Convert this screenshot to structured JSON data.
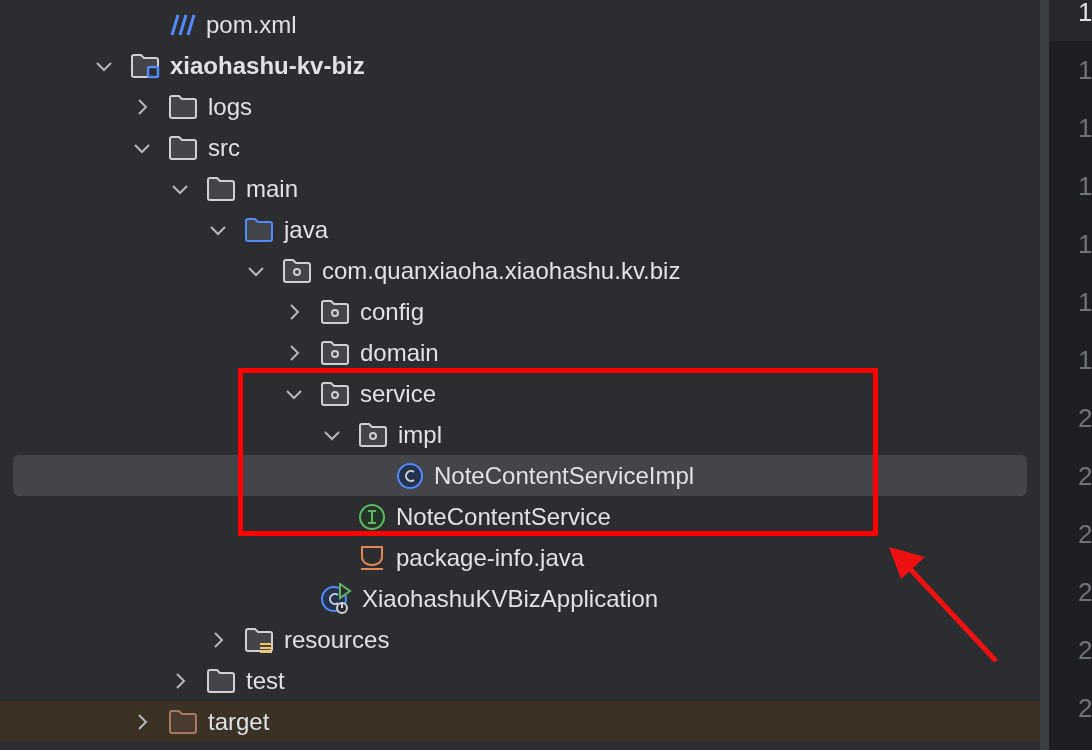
{
  "project_tree": {
    "items": [
      {
        "kind": "offscreen",
        "children": [
          {
            "name": "pom.xml",
            "kind": "xml"
          }
        ]
      },
      {
        "name": "xiaohashu-kv-biz",
        "kind": "module",
        "expanded": true,
        "selected": false,
        "children": [
          {
            "name": "logs",
            "kind": "folder",
            "expanded": false,
            "selected": false
          },
          {
            "name": "src",
            "kind": "folder",
            "expanded": true,
            "selected": false,
            "children": [
              {
                "name": "main",
                "kind": "folder",
                "expanded": true,
                "selected": false,
                "children": [
                  {
                    "name": "java",
                    "kind": "source",
                    "expanded": true,
                    "selected": false,
                    "children": [
                      {
                        "name": "com.quanxiaoha.xiaohashu.kv.biz",
                        "kind": "package",
                        "expanded": true,
                        "selected": false,
                        "children": [
                          {
                            "name": "config",
                            "kind": "package",
                            "expanded": false,
                            "selected": false
                          },
                          {
                            "name": "domain",
                            "kind": "package",
                            "expanded": false,
                            "selected": false
                          },
                          {
                            "name": "service",
                            "kind": "package",
                            "expanded": true,
                            "selected": false,
                            "children": [
                              {
                                "name": "impl",
                                "kind": "package",
                                "expanded": true,
                                "selected": false,
                                "children": [
                                  {
                                    "name": "NoteContentServiceImpl",
                                    "kind": "class",
                                    "selected": true
                                  }
                                ]
                              },
                              {
                                "name": "NoteContentService",
                                "kind": "interface",
                                "selected": false
                              },
                              {
                                "name": "package-info.java",
                                "kind": "package-info",
                                "selected": false
                              }
                            ]
                          },
                          {
                            "name": "XiaohashuKVBizApplication",
                            "kind": "spring-app",
                            "selected": false
                          }
                        ]
                      }
                    ]
                  },
                  {
                    "name": "resources",
                    "kind": "resources",
                    "expanded": false,
                    "selected": false
                  }
                ]
              },
              {
                "name": "test",
                "kind": "folder",
                "expanded": false,
                "selected": false
              }
            ]
          },
          {
            "name": "target",
            "kind": "excluded",
            "expanded": false,
            "selected": false
          }
        ]
      }
    ]
  },
  "editor_gutter": {
    "line_numbers": [
      {
        "text": "1",
        "current": true
      },
      {
        "text": "1",
        "current": false
      },
      {
        "text": "1",
        "current": false
      },
      {
        "text": "1",
        "current": false
      },
      {
        "text": "1",
        "current": false
      },
      {
        "text": "1",
        "current": false
      },
      {
        "text": "1",
        "current": false
      },
      {
        "text": "2",
        "current": false
      },
      {
        "text": "2",
        "current": false
      },
      {
        "text": "2",
        "current": false
      },
      {
        "text": "2",
        "current": false
      },
      {
        "text": "2",
        "current": false
      },
      {
        "text": "2",
        "current": false
      }
    ]
  }
}
